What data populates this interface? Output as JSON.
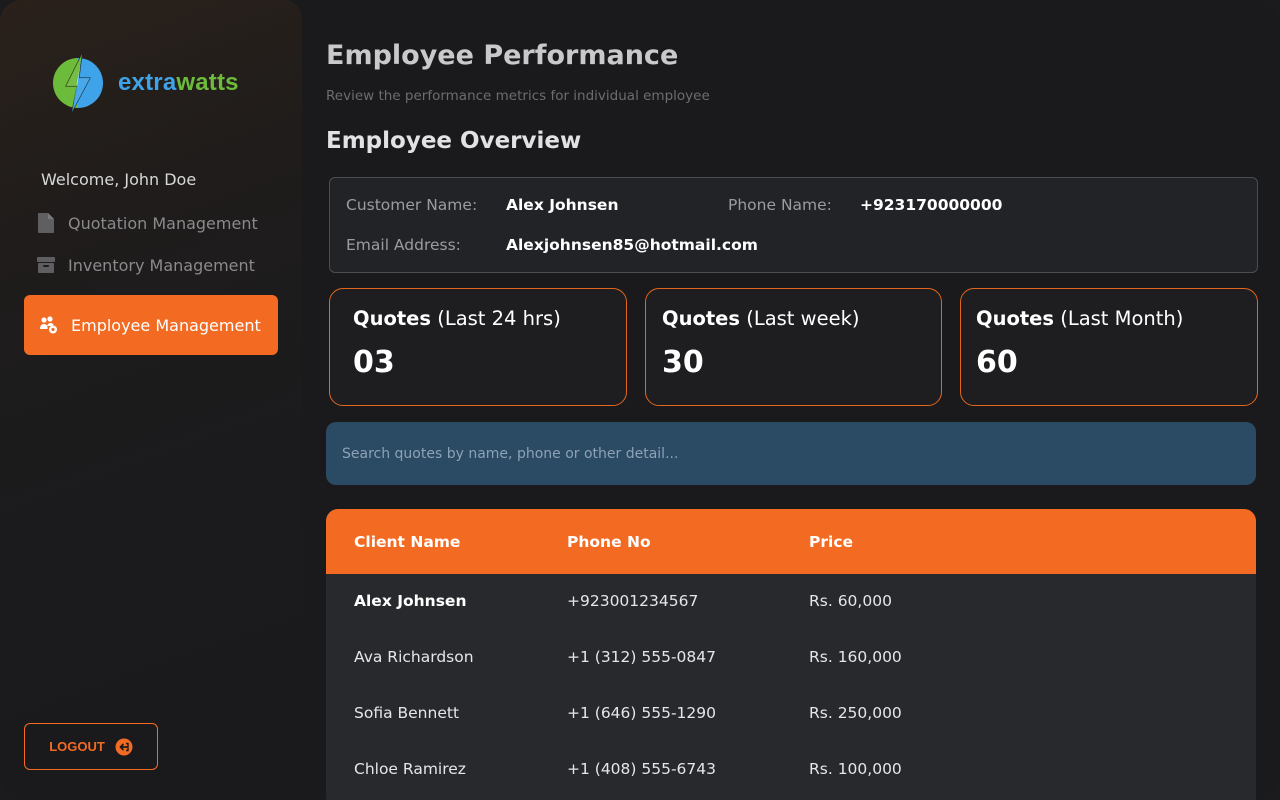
{
  "brand": {
    "name_part1": "extra",
    "name_part2": "watts",
    "color_blue": "#3ea3e8",
    "color_green": "#6dbb3a"
  },
  "sidebar": {
    "welcome": "Welcome, John Doe",
    "items": [
      {
        "label": "Quotation Management",
        "icon": "document-icon"
      },
      {
        "label": "Inventory Management",
        "icon": "archive-box-icon"
      },
      {
        "label": "Employee Management",
        "icon": "users-gear-icon",
        "active": true
      }
    ],
    "logout_label": "LOGOUT"
  },
  "header": {
    "title": "Employee Performance",
    "subtitle": "Review the performance metrics for individual employee",
    "section_title": "Employee Overview"
  },
  "overview": {
    "customer_label": "Customer Name:",
    "customer_value": "Alex Johnsen",
    "phone_label": "Phone Name:",
    "phone_value": "+923170000000",
    "email_label": "Email Address:",
    "email_value": "Alexjohnsen85@hotmail.com"
  },
  "stats": [
    {
      "label_bold": "Quotes",
      "label_rest": "(Last 24 hrs)",
      "value": "03"
    },
    {
      "label_bold": "Quotes",
      "label_rest": "(Last week)",
      "value": "30"
    },
    {
      "label_bold": "Quotes",
      "label_rest": "(Last Month)",
      "value": "60"
    }
  ],
  "search": {
    "placeholder": "Search quotes by name, phone or other detail..."
  },
  "table": {
    "headers": [
      "Client Name",
      "Phone No",
      "Price"
    ],
    "rows": [
      {
        "name": "Alex Johnsen",
        "phone": "+923001234567",
        "price": "Rs. 60,000"
      },
      {
        "name": "Ava Richardson",
        "phone": "+1 (312) 555-0847",
        "price": "Rs. 160,000"
      },
      {
        "name": "Sofia Bennett",
        "phone": "+1 (646) 555-1290",
        "price": "Rs. 250,000"
      },
      {
        "name": "Chloe Ramirez",
        "phone": "+1 (408) 555-6743",
        "price": "Rs. 100,000"
      }
    ]
  },
  "colors": {
    "accent": "#f36b22",
    "search_bg": "#2b4a63"
  }
}
